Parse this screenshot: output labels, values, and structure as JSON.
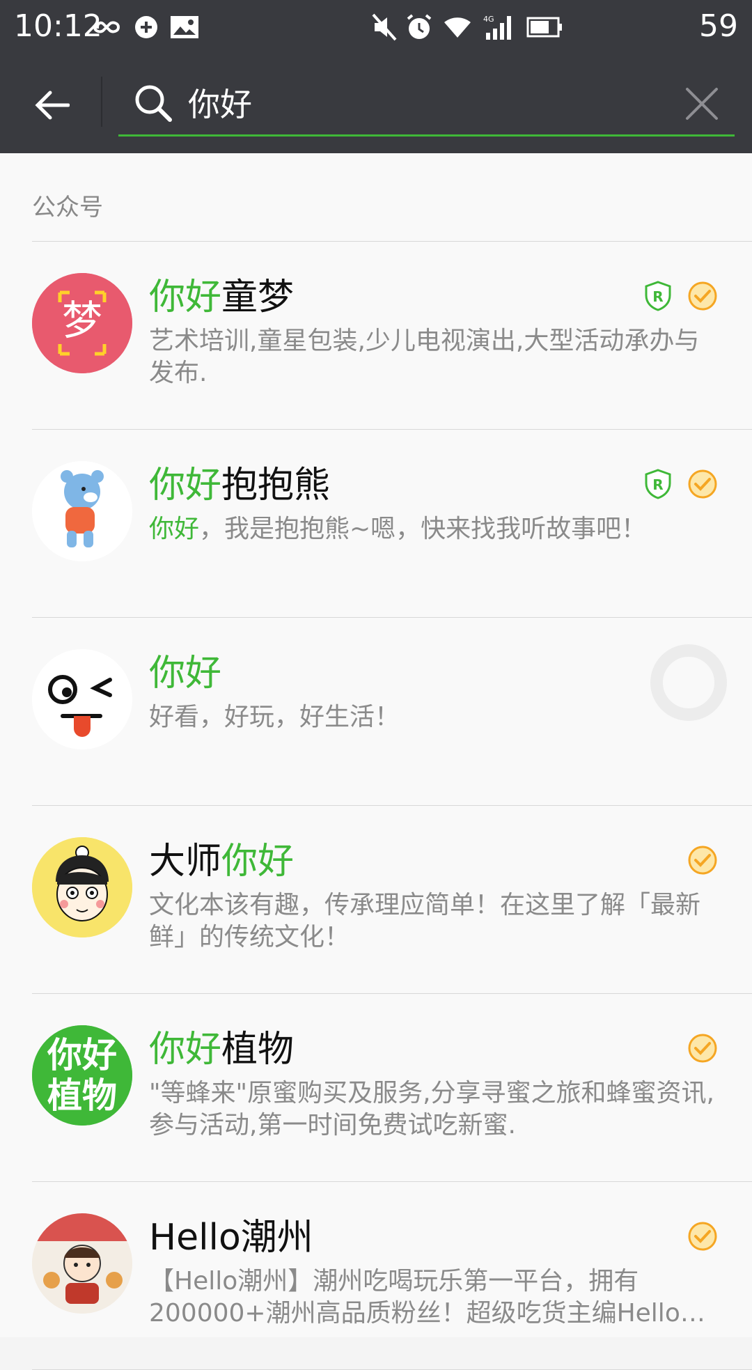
{
  "status": {
    "time": "10:12",
    "battery": "59",
    "network": "4G"
  },
  "search": {
    "query": "你好"
  },
  "section_title": "公众号",
  "results": [
    {
      "title_pre": "",
      "title_hl": "你好",
      "title_post": "童梦",
      "desc_hl": "",
      "desc": "艺术培训,童星包装,少儿电视演出,大型活动承办与发布.",
      "avatar": "dream-logo",
      "avatar_text": "梦",
      "badges": [
        "shield-r-icon",
        "verified-icon"
      ]
    },
    {
      "title_pre": "",
      "title_hl": "你好",
      "title_post": "抱抱熊",
      "desc_hl": "你好",
      "desc": "，我是抱抱熊~嗯，快来找我听故事吧！",
      "avatar": "bear",
      "badges": [
        "shield-r-icon",
        "verified-icon"
      ]
    },
    {
      "title_pre": "",
      "title_hl": "你好",
      "title_post": "",
      "desc_hl": "",
      "desc": "好看，好玩，好生活！",
      "avatar": "wink-face",
      "badges": []
    },
    {
      "title_pre": "大师",
      "title_hl": "你好",
      "title_post": "",
      "desc_hl": "",
      "desc": "文化本该有趣，传承理应简单！在这里了解「最新鲜」的传统文化！",
      "avatar": "boy-face",
      "badges": [
        "verified-icon"
      ]
    },
    {
      "title_pre": "",
      "title_hl": "你好",
      "title_post": "植物",
      "desc_hl": "",
      "desc": "\"等蜂来\"原蜜购买及服务,分享寻蜜之旅和蜂蜜资讯,参与活动,第一时间免费试吃新蜜.",
      "avatar": "plant-logo",
      "avatar_text": "你好植物",
      "badges": [
        "verified-icon"
      ]
    },
    {
      "title_pre": "Hello潮州",
      "title_hl": "",
      "title_post": "",
      "desc_hl": "",
      "desc": "【Hello潮州】潮州吃喝玩乐第一平台，拥有200000+潮州高品质粉丝！超级吃货主编Hello…",
      "avatar": "chaozhou-logo",
      "badges": [
        "verified-icon"
      ]
    }
  ],
  "colors": {
    "bar": "#393a3f",
    "accent": "#3fb838",
    "badge_orange": "#f5a623"
  }
}
